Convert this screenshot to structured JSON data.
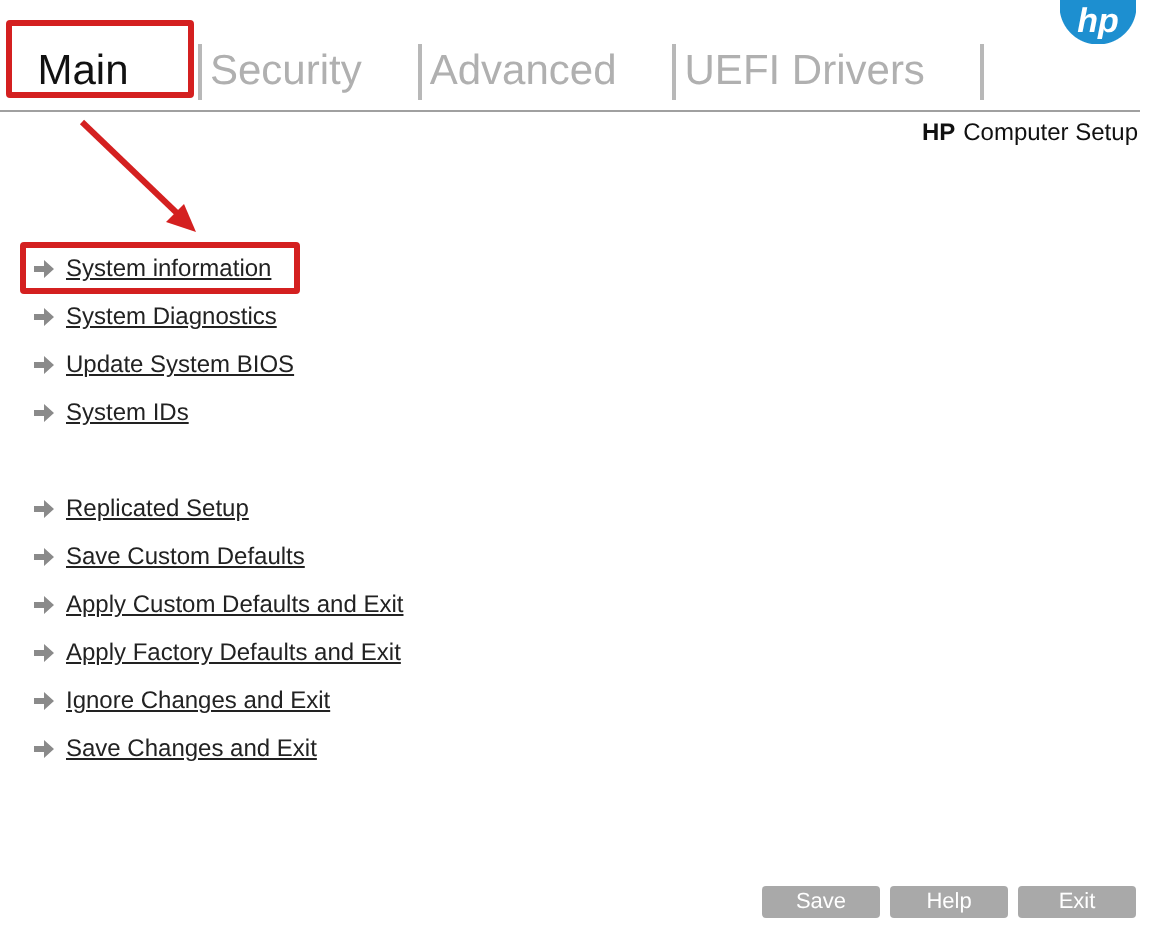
{
  "logo": "hp",
  "tabs": [
    {
      "label": "Main",
      "selected": true,
      "highlighted": true
    },
    {
      "label": "Security",
      "selected": false,
      "highlighted": false
    },
    {
      "label": "Advanced",
      "selected": false,
      "highlighted": false
    },
    {
      "label": "UEFI Drivers",
      "selected": false,
      "highlighted": false
    }
  ],
  "subtitle": {
    "brand": "HP",
    "text": "Computer Setup"
  },
  "menu_groups": [
    [
      {
        "label": "System information",
        "highlighted": true
      },
      {
        "label": "System Diagnostics",
        "highlighted": false
      },
      {
        "label": "Update System BIOS",
        "highlighted": false
      },
      {
        "label": "System IDs",
        "highlighted": false
      }
    ],
    [
      {
        "label": "Replicated Setup",
        "highlighted": false
      },
      {
        "label": "Save Custom Defaults",
        "highlighted": false
      },
      {
        "label": "Apply Custom Defaults and Exit",
        "highlighted": false
      },
      {
        "label": "Apply Factory Defaults and Exit",
        "highlighted": false
      },
      {
        "label": "Ignore Changes and Exit",
        "highlighted": false
      },
      {
        "label": "Save Changes and Exit",
        "highlighted": false
      }
    ]
  ],
  "buttons": [
    "Save",
    "Help",
    "Exit"
  ]
}
